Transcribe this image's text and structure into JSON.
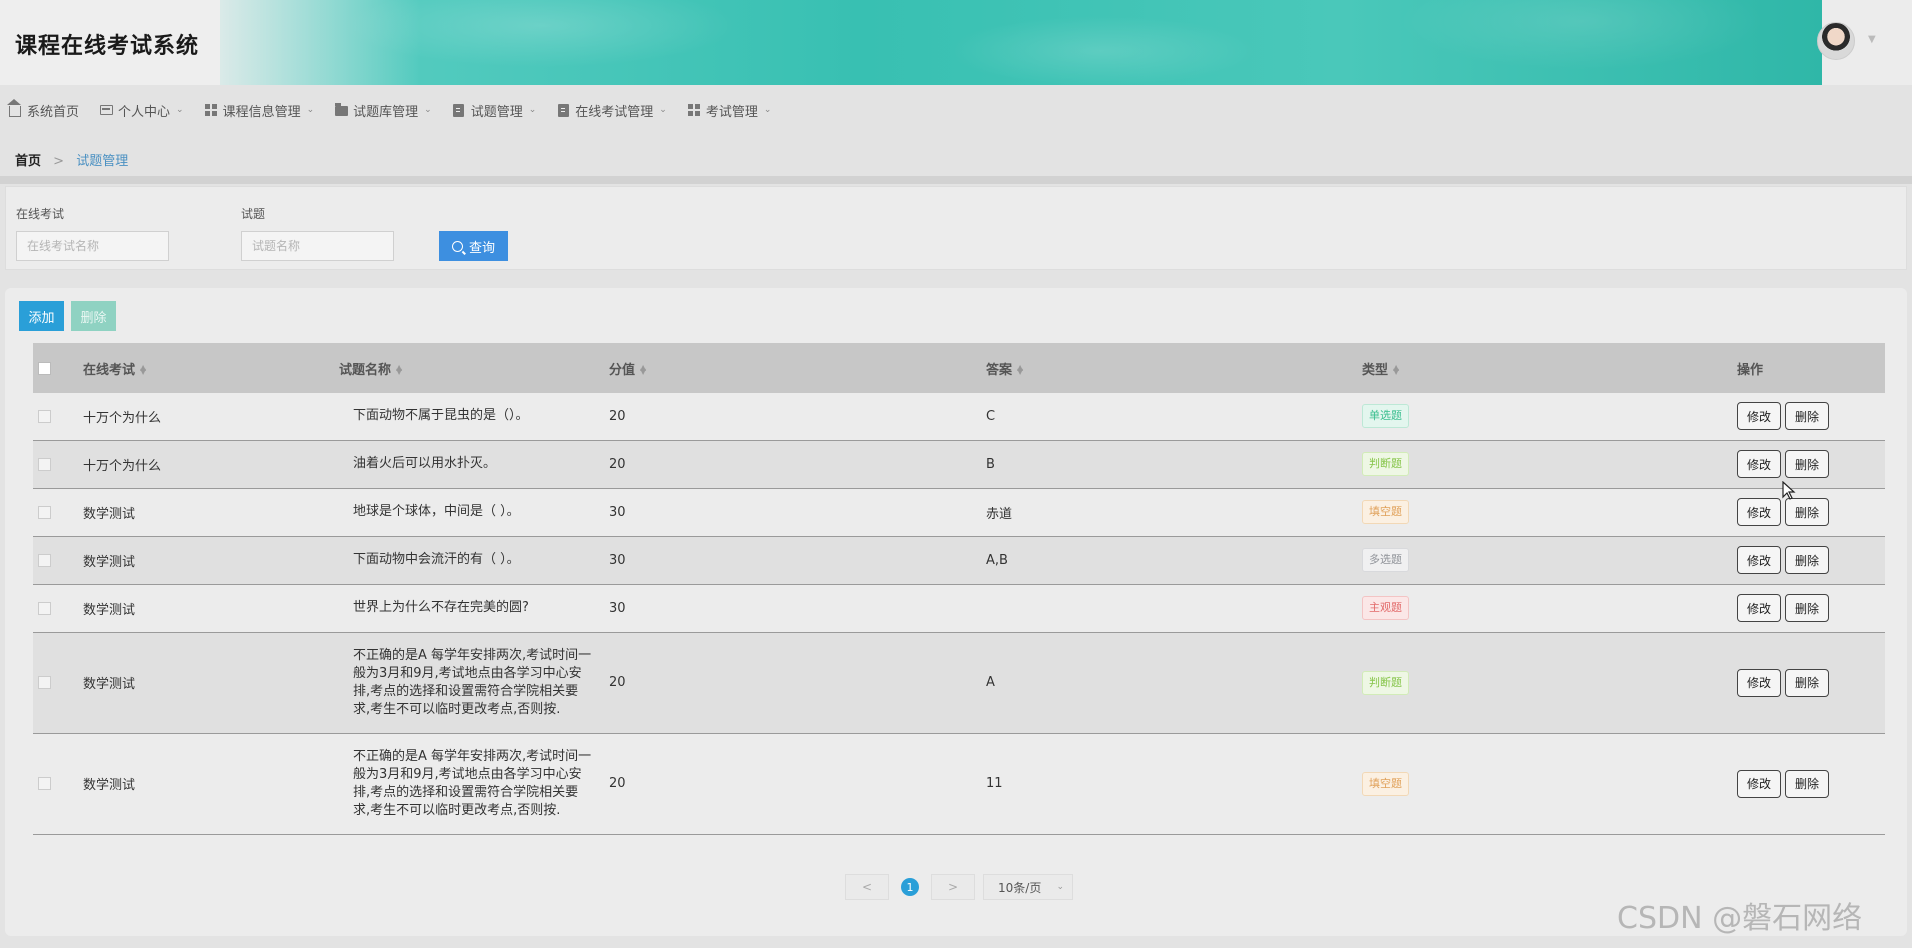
{
  "header": {
    "title": "课程在线考试系统"
  },
  "nav": {
    "items": [
      {
        "label": "系统首页",
        "icon": "home-icon",
        "dropdown": false
      },
      {
        "label": "个人中心",
        "icon": "card-icon",
        "dropdown": true
      },
      {
        "label": "课程信息管理",
        "icon": "grid-icon",
        "dropdown": true
      },
      {
        "label": "试题库管理",
        "icon": "folder-icon",
        "dropdown": true
      },
      {
        "label": "试题管理",
        "icon": "clipboard-icon",
        "dropdown": true
      },
      {
        "label": "在线考试管理",
        "icon": "clipboard-icon",
        "dropdown": true
      },
      {
        "label": "考试管理",
        "icon": "grid-icon",
        "dropdown": true
      }
    ]
  },
  "breadcrumb": {
    "home": "首页",
    "separator": ">",
    "current": "试题管理"
  },
  "search": {
    "exam_label": "在线考试",
    "exam_placeholder": "在线考试名称",
    "question_label": "试题",
    "question_placeholder": "试题名称",
    "button_label": "查询"
  },
  "toolbar": {
    "add_label": "添加",
    "delete_label": "删除"
  },
  "table": {
    "headers": {
      "exam": "在线考试",
      "question": "试题名称",
      "score": "分值",
      "answer": "答案",
      "type": "类型",
      "actions": "操作"
    },
    "edit_label": "修改",
    "delete_label": "删除",
    "rows": [
      {
        "exam": "十万个为什么",
        "question": "下面动物不属于昆虫的是（）。",
        "score": "20",
        "answer": "C",
        "type": "单选题",
        "type_style": "single"
      },
      {
        "exam": "十万个为什么",
        "question": "油着火后可以用水扑灭。",
        "score": "20",
        "answer": "B",
        "type": "判断题",
        "type_style": "judge"
      },
      {
        "exam": "数学测试",
        "question": "地球是个球体，中间是（ ）。",
        "score": "30",
        "answer": "赤道",
        "type": "填空题",
        "type_style": "fill"
      },
      {
        "exam": "数学测试",
        "question": "下面动物中会流汗的有（ ）。",
        "score": "30",
        "answer": "A,B",
        "type": "多选题",
        "type_style": "multi"
      },
      {
        "exam": "数学测试",
        "question": "世界上为什么不存在完美的圆?",
        "score": "30",
        "answer": "",
        "type": "主观题",
        "type_style": "subj"
      },
      {
        "exam": "数学测试",
        "question": "不正确的是A 每学年安排两次,考试时间一般为3月和9月,考试地点由各学习中心安排,考点的选择和设置需符合学院相关要求,考生不可以临时更改考点,否则按.",
        "score": "20",
        "answer": "A",
        "type": "判断题",
        "type_style": "judge"
      },
      {
        "exam": "数学测试",
        "question": "不正确的是A 每学年安排两次,考试时间一般为3月和9月,考试地点由各学习中心安排,考点的选择和设置需符合学院相关要求,考生不可以临时更改考点,否则按.",
        "score": "20",
        "answer": "11",
        "type": "填空题",
        "type_style": "fill"
      }
    ]
  },
  "pagination": {
    "prev": "<",
    "current_page": "1",
    "next": ">",
    "page_size": "10条/页"
  },
  "watermark": "CSDN @磐石网络",
  "colors": {
    "primary": "#2a9fd8",
    "search_button": "#3d8fe0",
    "banner": "#38c0b2"
  }
}
